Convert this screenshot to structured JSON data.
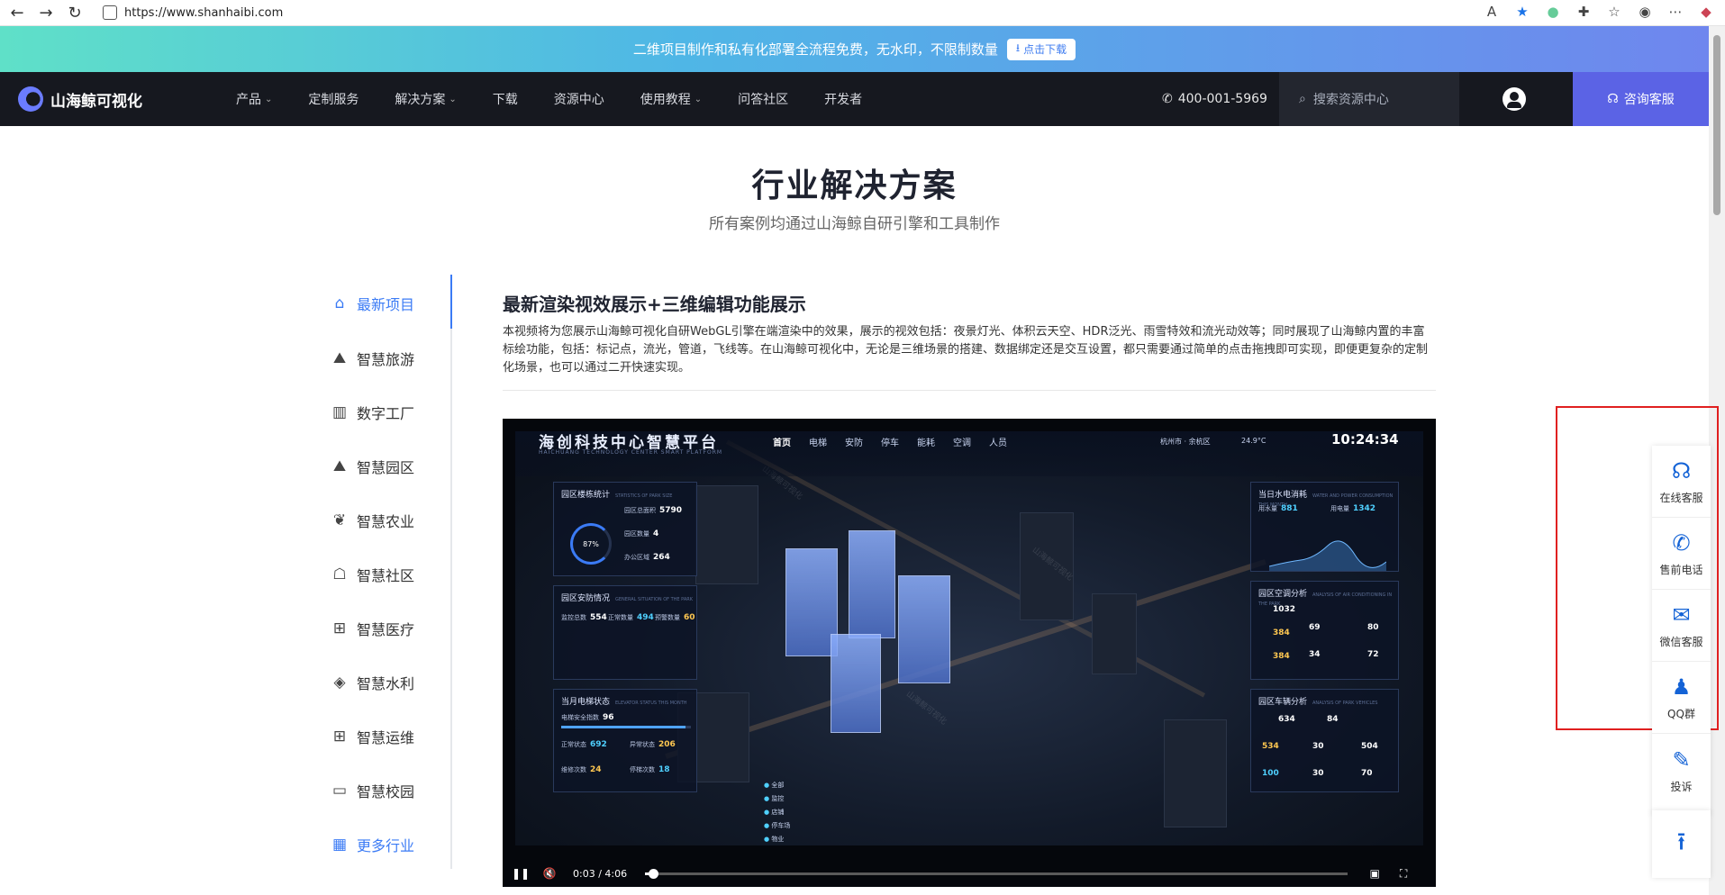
{
  "browser": {
    "url": "https://www.shanhaibi.com",
    "back_icon": "←",
    "forward_icon": "→",
    "reload_icon": "↻",
    "tools": [
      "read-aloud-icon",
      "star-icon",
      "extension-icon",
      "puzzle-icon",
      "favorites-icon",
      "profile-icon",
      "more-icon",
      "copilot-icon"
    ]
  },
  "promo": {
    "text": "二维项目制作和私有化部署全流程免费，无水印，不限制数量",
    "button_label": "点击下载"
  },
  "nav": {
    "logo_text": "山海鲸可视化",
    "items": [
      {
        "label": "产品",
        "caret": "⌄"
      },
      {
        "label": "定制服务",
        "caret": ""
      },
      {
        "label": "解决方案",
        "caret": "⌄"
      },
      {
        "label": "下载",
        "caret": ""
      },
      {
        "label": "资源中心",
        "caret": ""
      },
      {
        "label": "使用教程",
        "caret": "⌄"
      },
      {
        "label": "问答社区",
        "caret": ""
      },
      {
        "label": "开发者",
        "caret": ""
      }
    ],
    "phone": "400-001-5969",
    "search_placeholder": "搜索资源中心",
    "consult_label": "咨询客服"
  },
  "page": {
    "title": "行业解决方案",
    "subtitle": "所有案例均通过山海鲸自研引擎和工具制作"
  },
  "sidebar": {
    "items": [
      {
        "label": "最新项目",
        "icon": "⌂"
      },
      {
        "label": "智慧旅游",
        "icon": "⛰"
      },
      {
        "label": "数字工厂",
        "icon": "▥"
      },
      {
        "label": "智慧园区",
        "icon": "⛰"
      },
      {
        "label": "智慧农业",
        "icon": "❦"
      },
      {
        "label": "智慧社区",
        "icon": "☖"
      },
      {
        "label": "智慧医疗",
        "icon": "⊞"
      },
      {
        "label": "智慧水利",
        "icon": "◈"
      },
      {
        "label": "智慧运维",
        "icon": "⊞"
      },
      {
        "label": "智慧校园",
        "icon": "▭"
      },
      {
        "label": "更多行业",
        "icon": "▦"
      }
    ]
  },
  "content": {
    "title": "最新渲染视效展示+三维编辑功能展示",
    "description": "本视频将为您展示山海鲸可视化自研WebGL引擎在端渲染中的效果，展示的视效包括：夜景灯光、体积云天空、HDR泛光、雨雪特效和流光动效等；同时展现了山海鲸内置的丰富标绘功能，包括：标记点，流光，管道，飞线等。在山海鲸可视化中，无论是三维场景的搭建、数据绑定还是交互设置，都只需要通过简单的点击拖拽即可实现，即便更复杂的定制化场景，也可以通过二开快速实现。"
  },
  "video": {
    "hud": {
      "title": "海创科技中心智慧平台",
      "subtitle": "HAICHUANG TECHNOLOGY CENTER SMART PLATFORM",
      "tabs": [
        "首页",
        "电梯",
        "安防",
        "停车",
        "能耗",
        "空调",
        "人员"
      ],
      "location": "杭州市 · 余杭区",
      "weather": "24.9°C",
      "clock": "10:24:34"
    },
    "panels": {
      "park_stats": {
        "title": "园区楼栋统计",
        "sub": "STATISTICS OF PARK SIZE",
        "area_label": "园区总面积",
        "area": "5790",
        "buildings_label": "园区数量",
        "buildings": "4",
        "office_label": "办公区域",
        "office": "264",
        "ring": "87%"
      },
      "security": {
        "title": "园区安防情况",
        "sub": "GENERAL SITUATION OF THE PARK",
        "monitors_label": "监控总数",
        "monitors": "554",
        "normal_label": "正常数量",
        "normal": "494",
        "abnormal_label": "预警数量",
        "abnormal": "60"
      },
      "elevator": {
        "title": "当月电梯状态",
        "sub": "ELEVATOR STATUS THIS MONTH",
        "safety_label": "电梯安全指数",
        "safety": "96",
        "normal_label": "正常状态",
        "normal": "692",
        "abnormal_label": "异常状态",
        "abnormal": "206",
        "repair_label": "维修次数",
        "repair": "24",
        "stop_label": "停梯次数",
        "stop": "18"
      },
      "power": {
        "title": "当日水电消耗",
        "sub": "WATER AND POWER CONSUMPTION THIS MONTH",
        "water_label": "用水量",
        "water": "881",
        "power_label": "用电量",
        "power": "1342"
      },
      "hvac": {
        "title": "园区空调分析",
        "sub": "ANALYSIS OF AIR CONDITIONING IN THE PARK",
        "total": "1032",
        "on": "384",
        "off": "384",
        "v1": "69",
        "v2": "34",
        "v3": "80",
        "v4": "72"
      },
      "parking": {
        "title": "园区车辆分析",
        "sub": "ANALYSIS OF PARK VEHICLES",
        "total": "634",
        "rate": "84",
        "used": "534",
        "ground": "30",
        "under": "504",
        "free": "100",
        "g2": "30",
        "u2": "70"
      }
    },
    "legend": [
      "全部",
      "监控",
      "店铺",
      "停车场",
      "物业"
    ],
    "time_current": "0:03",
    "time_total": "4:06",
    "progress": 0.012
  },
  "float_widget": {
    "items": [
      {
        "label": "在线客服",
        "icon": "☊"
      },
      {
        "label": "售前电话",
        "icon": "✆"
      },
      {
        "label": "微信客服",
        "icon": "✉"
      },
      {
        "label": "QQ群",
        "icon": "♟"
      },
      {
        "label": "投诉",
        "icon": "✎"
      }
    ],
    "top_icon": "⭱"
  }
}
